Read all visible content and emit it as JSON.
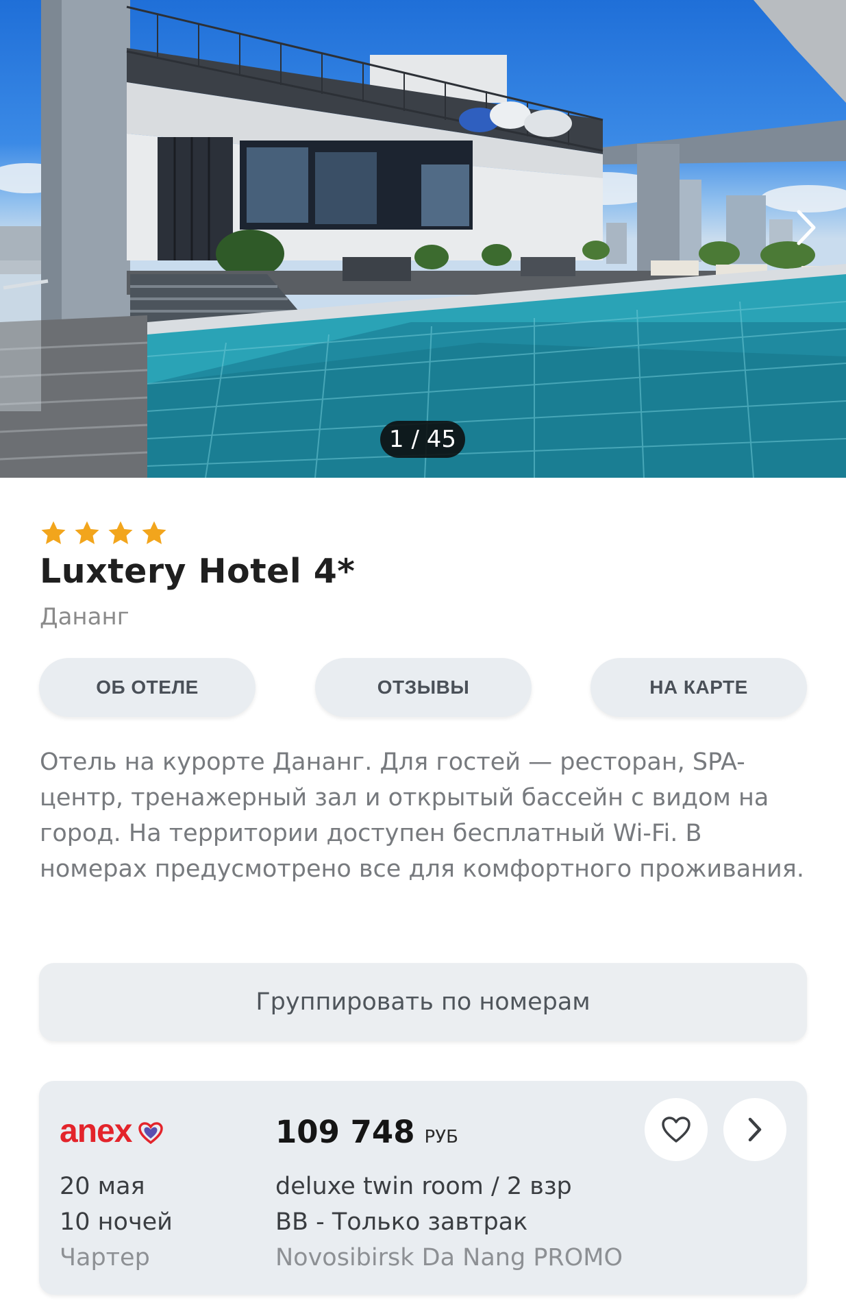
{
  "gallery": {
    "counter": "1 / 45",
    "current": 1,
    "total": 45,
    "next_icon": "chevron-right-icon"
  },
  "hotel": {
    "stars": 4,
    "star_color": "#f2a51c",
    "name": "Luxtery Hotel 4*",
    "city": "Дананг",
    "tabs": [
      "ОБ ОТЕЛЕ",
      "ОТЗЫВЫ",
      "НА КАРТЕ"
    ],
    "description": "Отель на курорте Дананг. Для гостей — ресторан, SPA-центр, тренажерный зал и открытый бассейн с видом на город. На территории доступен бесплатный Wi-Fi. В номерах предусмотрено все для комфортного проживания."
  },
  "group_button": "Группировать по номерам",
  "offer": {
    "operator_logo_text": "anex",
    "operator_color": "#e3242b",
    "price": "109 748",
    "currency": "РУБ",
    "date": "20 мая",
    "nights": "10 ночей",
    "flight_type": "Чартер",
    "room": "deluxe twin room / 2 взр",
    "meal": "BB - Только завтрак",
    "tour": "Novosibirsk Da Nang PROMO",
    "favorite_icon": "heart-outline-icon",
    "open_icon": "chevron-right-icon"
  }
}
